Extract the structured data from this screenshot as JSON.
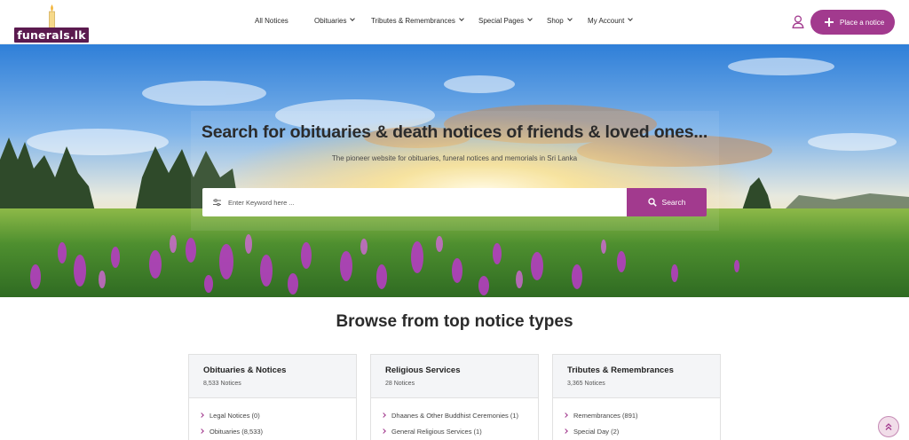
{
  "brand": {
    "logo_text": "funerals.lk"
  },
  "nav": {
    "items": [
      {
        "label": "All Notices",
        "dropdown": false
      },
      {
        "label": "Obituaries",
        "dropdown": true
      },
      {
        "label": "Tributes & Remembrances",
        "dropdown": true
      },
      {
        "label": "Special Pages",
        "dropdown": true
      },
      {
        "label": "Shop",
        "dropdown": true
      },
      {
        "label": "My Account",
        "dropdown": true
      }
    ],
    "place_notice_label": "Place a notice"
  },
  "hero": {
    "title": "Search for obituaries & death notices of friends & loved ones...",
    "subtitle": "The pioneer website for obituaries, funeral notices and memorials in Sri Lanka",
    "search_placeholder": "Enter Keyword here ...",
    "search_button": "Search"
  },
  "browse": {
    "title": "Browse from top notice types",
    "cards": [
      {
        "title": "Obituaries & Notices",
        "count": "8,533 Notices",
        "items": [
          "Legal Notices (0)",
          "Obituaries (8,533)"
        ]
      },
      {
        "title": "Religious Services",
        "count": "28 Notices",
        "items": [
          "Dhaanes & Other Buddhist Ceremonies (1)",
          "General Religious Services (1)"
        ]
      },
      {
        "title": "Tributes & Remembrances",
        "count": "3,365 Notices",
        "items": [
          "Remembrances (891)",
          "Special Day (2)"
        ]
      }
    ]
  },
  "colors": {
    "accent": "#a23a8e",
    "logo_bg": "#5b1a4f"
  },
  "icons": {
    "user": "user-icon",
    "plus": "plus-icon",
    "filter": "filter-icon",
    "search": "search-icon",
    "back_to_top": "double-chevron-up-icon"
  }
}
